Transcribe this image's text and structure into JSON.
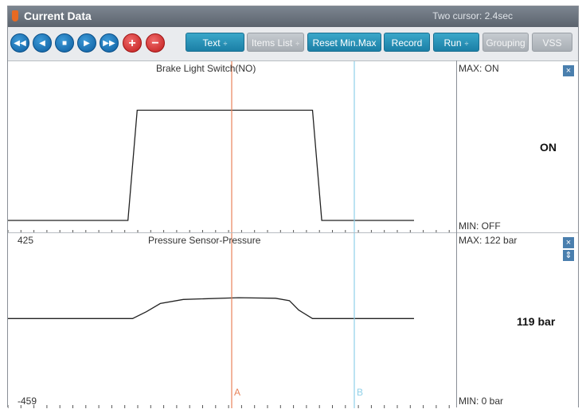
{
  "window": {
    "title": "Current Data",
    "cursor_info": "Two cursor: 2.4sec",
    "accent": "#1b7fa6"
  },
  "toolbar": {
    "nav_icons": [
      "rewind-icon",
      "step-back-icon",
      "stop-icon",
      "play-icon",
      "fast-forward-icon"
    ],
    "zoom_in_glyph": "+",
    "zoom_out_glyph": "−",
    "buttons": {
      "text": "Text",
      "items_list": "Items List",
      "reset": "Reset Min.Max",
      "record": "Record",
      "run": "Run",
      "grouping": "Grouping",
      "vss": "VSS"
    },
    "dropdown_arrow": "÷"
  },
  "panels": [
    {
      "title": "Brake Light Switch(NO)",
      "max_label": "MAX: ON",
      "min_label": "MIN: OFF",
      "current_value": "ON",
      "y_top_label": "",
      "y_bottom_label": "",
      "close_glyph": "×"
    },
    {
      "title": "Pressure Sensor-Pressure",
      "max_label": "MAX:   122 bar",
      "min_label": "MIN:     0 bar",
      "current_value": "119 bar",
      "y_top_label": "425",
      "y_bottom_label": "-459",
      "close_glyph": "×",
      "extra_glyph": "⇕"
    }
  ],
  "cursors": [
    {
      "label": "A",
      "color": "#e8835a"
    },
    {
      "label": "B",
      "color": "#8fd0e8"
    }
  ],
  "chart_data": [
    {
      "type": "line",
      "title": "Brake Light Switch(NO)",
      "series": [
        {
          "x": [
            0,
            26,
            28,
            66,
            68,
            88
          ],
          "y": [
            0,
            0,
            1,
            1,
            0,
            0
          ]
        }
      ],
      "ylim": [
        0,
        1.3
      ]
    },
    {
      "type": "line",
      "title": "Pressure Sensor-Pressure",
      "series": [
        {
          "x": [
            0,
            27,
            30,
            33,
            38,
            50,
            58,
            61,
            63,
            66,
            88
          ],
          "y": [
            0,
            0,
            40,
            88,
            112,
            122,
            119,
            105,
            50,
            0,
            0
          ]
        }
      ],
      "ylim": [
        -459,
        425
      ]
    }
  ]
}
